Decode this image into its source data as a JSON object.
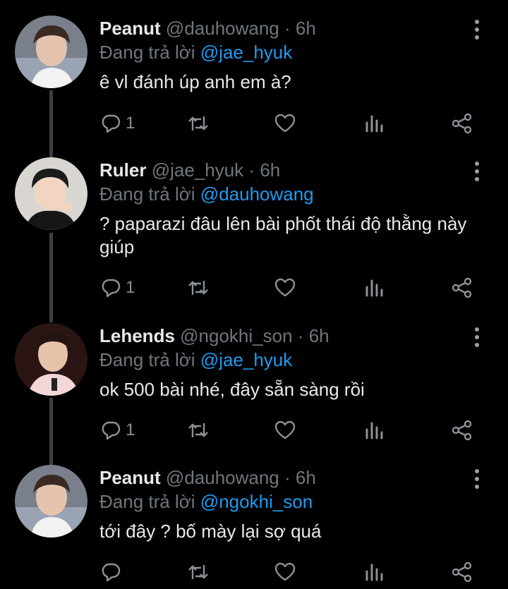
{
  "tweets": [
    {
      "name": "Peanut",
      "handle": "@dauhowang",
      "sep": "·",
      "time": "6h",
      "reply_prefix": "Đang trả lời",
      "reply_to": "@jae_hyuk",
      "text": "ê vl đánh úp anh em à?",
      "reply_count": "1",
      "avatar": "peanut-avatar"
    },
    {
      "name": "Ruler",
      "handle": "@jae_hyuk",
      "sep": "·",
      "time": "6h",
      "reply_prefix": "Đang trả lời",
      "reply_to": "@dauhowang",
      "text": "? paparazi đâu lên bài phốt thái độ thằng này giúp",
      "reply_count": "1",
      "avatar": "ruler-avatar"
    },
    {
      "name": "Lehends",
      "handle": "@ngokhi_son",
      "sep": "·",
      "time": "6h",
      "reply_prefix": "Đang trả lời",
      "reply_to": "@jae_hyuk",
      "text": "ok 500 bài nhé, đây sẵn sàng rồi",
      "reply_count": "1",
      "avatar": "lehends-avatar"
    },
    {
      "name": "Peanut",
      "handle": "@dauhowang",
      "sep": "·",
      "time": "6h",
      "reply_prefix": "Đang trả lời",
      "reply_to": "@ngokhi_son",
      "text": "tới đây ? bố mày lại sợ quá",
      "reply_count": "",
      "avatar": "peanut-avatar"
    }
  ],
  "icons": {
    "reply": "reply-icon",
    "retweet": "retweet-icon",
    "like": "heart-icon",
    "views": "analytics-icon",
    "share": "share-icon",
    "more": "more-vertical-icon"
  },
  "colors": {
    "background": "#000000",
    "link": "#1d9bf0",
    "muted": "#6f767d",
    "text": "#e7e9ea",
    "thread_line": "#3b3f44"
  }
}
